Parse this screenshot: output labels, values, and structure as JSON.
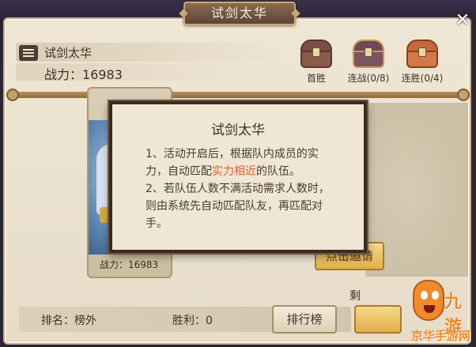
{
  "window": {
    "title": "试剑太华",
    "close_glyph": "✕"
  },
  "header": {
    "mode_title": "试剑太华",
    "power_label": "战力：",
    "power_value": "16983"
  },
  "chests": [
    {
      "label": "首胜"
    },
    {
      "label": "连战(0/8)"
    },
    {
      "label": "连胜(0/4)"
    }
  ],
  "card": {
    "power_label": "战力：",
    "power_value": "16983"
  },
  "background_button": {
    "label": "点击邀请"
  },
  "modal": {
    "title": "试剑太华",
    "rule1_a": "1、活动开启后，根据队内成员的实力，自动匹配",
    "rule1_highlight": "实力相近",
    "rule1_b": "的队伍。",
    "rule2": "2、若队伍人数不满活动需求人数时，则由系统先自动匹配队友，再匹配对手。"
  },
  "footer": {
    "rank_label": "排名：",
    "rank_value": "榜外",
    "wins_label": "胜利：",
    "wins_value": "0",
    "ranking_button": "排行榜",
    "remain_label": "剩"
  },
  "watermark": {
    "text1": "九游",
    "text2": "京华手游网"
  },
  "colors": {
    "panel": "#efe6d5",
    "text": "#3f3127",
    "highlight": "#e35d2f",
    "gold": "#e2ae4d"
  },
  "icons": {
    "menu": "list-icon",
    "close": "close-icon",
    "chests": [
      "wooden-chest-icon",
      "silver-chest-icon",
      "gold-chest-icon"
    ]
  }
}
